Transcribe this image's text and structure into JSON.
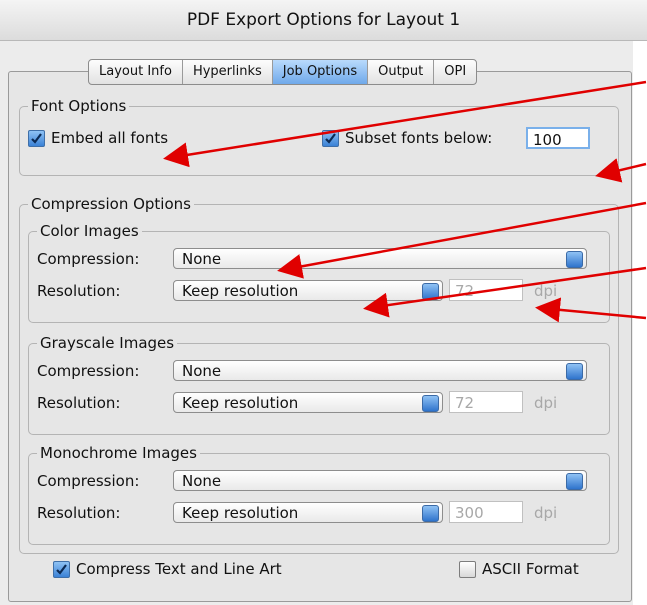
{
  "window": {
    "title": "PDF Export Options for Layout 1"
  },
  "tabs": [
    {
      "label": "Layout Info",
      "active": false
    },
    {
      "label": "Hyperlinks",
      "active": false
    },
    {
      "label": "Job Options",
      "active": true
    },
    {
      "label": "Output",
      "active": false
    },
    {
      "label": "OPI",
      "active": false
    }
  ],
  "font_options": {
    "legend": "Font Options",
    "embed_all_label": "Embed all fonts",
    "embed_all_checked": true,
    "subset_label": "Subset fonts below:",
    "subset_checked": true,
    "subset_value": "100"
  },
  "compression_options": {
    "legend": "Compression Options",
    "color_images": {
      "legend": "Color Images",
      "compression_label": "Compression:",
      "compression_value": "None",
      "resolution_label": "Resolution:",
      "resolution_value": "Keep resolution",
      "dpi_value": "72",
      "dpi_unit": "dpi"
    },
    "grayscale_images": {
      "legend": "Grayscale Images",
      "compression_label": "Compression:",
      "compression_value": "None",
      "resolution_label": "Resolution:",
      "resolution_value": "Keep resolution",
      "dpi_value": "72",
      "dpi_unit": "dpi"
    },
    "monochrome_images": {
      "legend": "Monochrome Images",
      "compression_label": "Compression:",
      "compression_value": "None",
      "resolution_label": "Resolution:",
      "resolution_value": "Keep resolution",
      "dpi_value": "300",
      "dpi_unit": "dpi"
    }
  },
  "bottom": {
    "compress_text_label": "Compress Text and Line Art",
    "compress_text_checked": true,
    "ascii_label": "ASCII Format",
    "ascii_checked": false
  },
  "colors": {
    "annotation_arrow": "#e00000",
    "tab_active": "#8ec0f4",
    "checkbox": "#3b82d6"
  }
}
